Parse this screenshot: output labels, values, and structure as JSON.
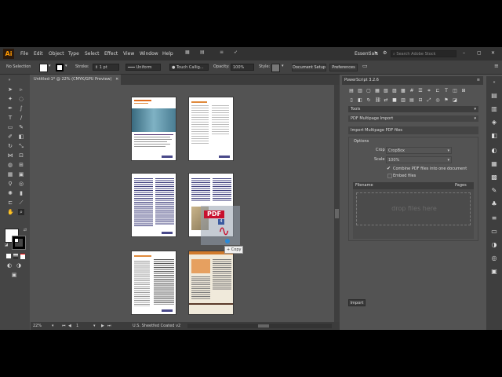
{
  "app": {
    "logo": "Ai"
  },
  "menu": {
    "items": [
      "File",
      "Edit",
      "Object",
      "Type",
      "Select",
      "Effect",
      "View",
      "Window",
      "Help"
    ],
    "workspace": "Essentials",
    "search_placeholder": "Search Adobe Stock"
  },
  "control": {
    "selection": "No Selection",
    "stroke_label": "Stroke:",
    "stroke_value": "1 pt",
    "profile": "Uniform",
    "brush": "Touch Callig...",
    "opacity_label": "Opacity:",
    "opacity_value": "100%",
    "style_label": "Style:",
    "doc_setup": "Document Setup",
    "preferences": "Preferences"
  },
  "document": {
    "tab": "Untitled-1* @ 22% (CMYK/GPU Preview)"
  },
  "status": {
    "zoom": "22%",
    "artboard": "1",
    "profile": "U.S. Sheetfed Coated v2"
  },
  "drag": {
    "pdf": "PDF",
    "count": "4",
    "copy": "+ Copy"
  },
  "panel": {
    "title": "PowerScript 3.2.6",
    "tools": "Tools",
    "script": "PDF Multipage Import",
    "section": "Import Multipage PDF files",
    "options": "Options",
    "crop_label": "Crop",
    "crop_value": "CropBox",
    "scale_label": "Scale",
    "scale_value": "100%",
    "combine": "Combine PDF files into one document",
    "embed": "Embed files",
    "col_filename": "Filename",
    "col_pages": "Pages",
    "drop": "drop files here",
    "import": "Import"
  },
  "colors": {
    "accent": "#ff9a00",
    "pdf_red": "#c8102e"
  }
}
